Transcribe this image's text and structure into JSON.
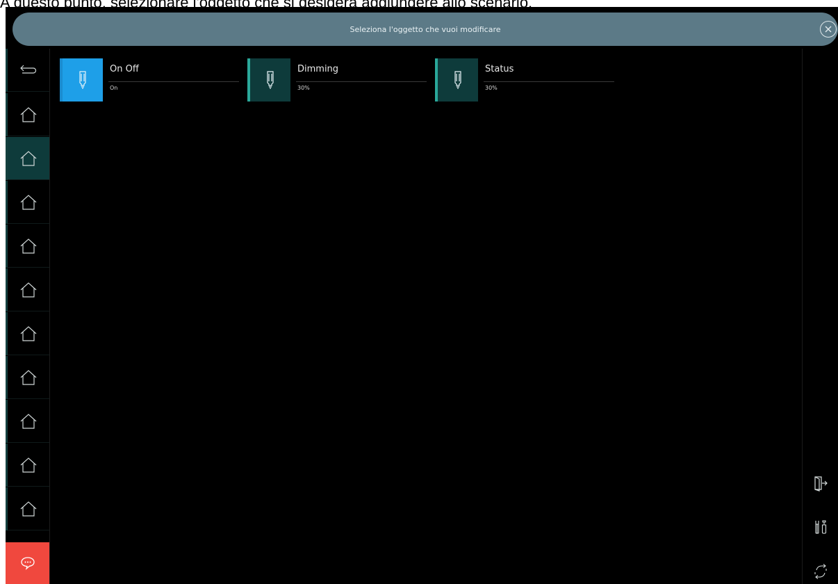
{
  "caption": "A questo punto, selezionare l'oggetto che si desidera aggiungere allo scenario.",
  "titlebar": {
    "title": "Seleziona l'oggetto che vuoi modificare",
    "close_icon": "close-circle-icon"
  },
  "sidebar": {
    "back_icon": "back-arrow-icon",
    "items": [
      {
        "icon": "home-icon",
        "active": false
      },
      {
        "icon": "home-icon",
        "active": true
      },
      {
        "icon": "home-icon",
        "active": false
      },
      {
        "icon": "home-icon",
        "active": false
      },
      {
        "icon": "home-icon",
        "active": false
      },
      {
        "icon": "home-icon",
        "active": false
      },
      {
        "icon": "home-icon",
        "active": false
      },
      {
        "icon": "home-icon",
        "active": false
      },
      {
        "icon": "home-icon",
        "active": false
      },
      {
        "icon": "home-icon",
        "active": false
      }
    ],
    "chat_icon": "chat-bubble-icon"
  },
  "tiles": [
    {
      "name": "On Off",
      "value": "On",
      "icon": "bulb-icon",
      "state": "on"
    },
    {
      "name": "Dimming",
      "value": "30%",
      "icon": "bulb-icon",
      "state": "off"
    },
    {
      "name": "Status",
      "value": "30%",
      "icon": "bulb-icon",
      "state": "off"
    }
  ],
  "right_bar": {
    "logout_icon": "logout-door-icon",
    "tools_icon": "tools-icon",
    "sync_icon": "sync-arrows-icon"
  },
  "colors": {
    "titlebar": "#5c7a87",
    "active_tile": "#1e9fe8",
    "inactive_tile": "#0e3b3b",
    "accent": "#2aa89a",
    "chat": "#f0483e"
  }
}
